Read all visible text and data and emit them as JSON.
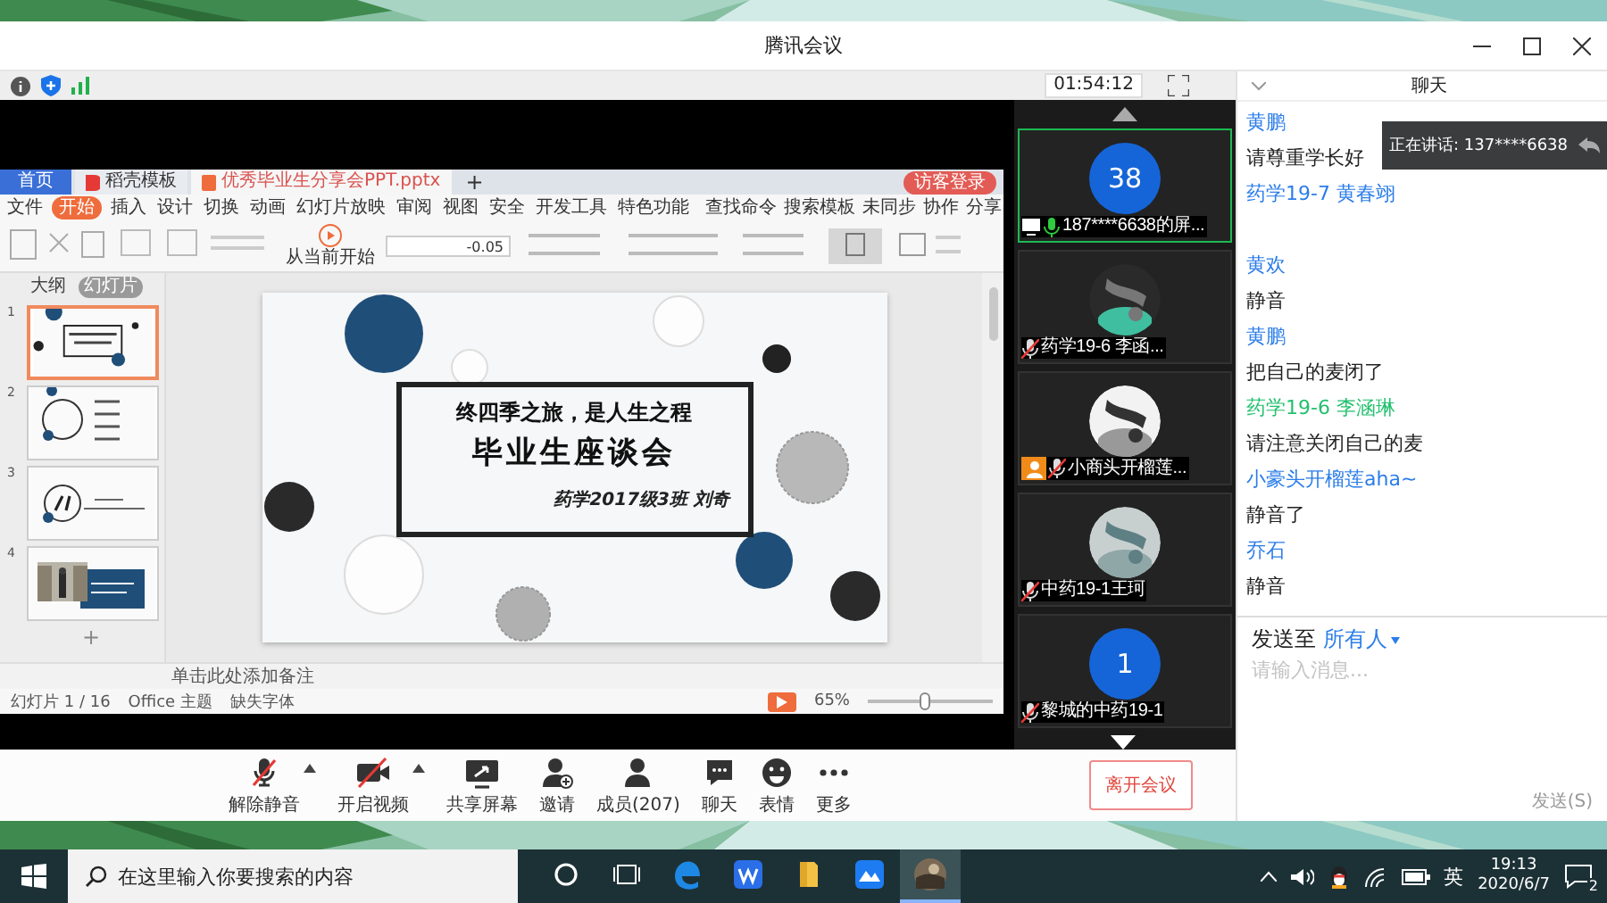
{
  "window": {
    "title": "腾讯会议"
  },
  "meeting_bar": {
    "timer": "01:54:12"
  },
  "shared_screen": {
    "tabs": [
      {
        "label": "首页",
        "kind": "home",
        "selected": false
      },
      {
        "label": "稻壳模板",
        "kind": "docer",
        "selected": false
      },
      {
        "label": "优秀毕业生分享会PPT.pptx",
        "kind": "document",
        "selected": true
      }
    ],
    "new_tab": "+",
    "login": "访客登录",
    "menu": [
      {
        "label": "文件",
        "selected": false
      },
      {
        "label": "开始",
        "selected": true
      },
      {
        "label": "插入",
        "selected": false
      },
      {
        "label": "设计",
        "selected": false
      },
      {
        "label": "切换",
        "selected": false
      },
      {
        "label": "动画",
        "selected": false
      },
      {
        "label": "幻灯片放映",
        "selected": false
      },
      {
        "label": "审阅",
        "selected": false
      },
      {
        "label": "视图",
        "selected": false
      },
      {
        "label": "安全",
        "selected": false
      },
      {
        "label": "开发工具",
        "selected": false
      },
      {
        "label": "特色功能",
        "selected": false
      }
    ],
    "search_command": "查找命令",
    "search_template": "搜索模板",
    "sync": "未同步",
    "collaborate": "协作",
    "share": "分享",
    "play_from_current": "从当前开始",
    "font_size": "-0.05",
    "panel_tabs": [
      {
        "label": "大纲",
        "selected": false
      },
      {
        "label": "幻灯片",
        "selected": true
      }
    ],
    "thumbnails": [
      {
        "number": "1",
        "selected": true,
        "kind": "title"
      },
      {
        "number": "2",
        "selected": false,
        "kind": "contents"
      },
      {
        "number": "3",
        "selected": false,
        "kind": "section"
      },
      {
        "number": "4",
        "selected": false
      }
    ],
    "add_slide": "+",
    "slide": {
      "line_1": "终四季之旅，是人生之程",
      "line_2": "毕业生座谈会",
      "author": "药学2017级3班 刘奇"
    },
    "notes_placeholder": "单击此处添加备注",
    "status": {
      "slide": "幻灯片 1 / 16",
      "theme": "Office 主题",
      "missing_fonts": "缺失字体",
      "zoom": "65%",
      "zoom_slider": {
        "level": 0.45
      }
    }
  },
  "participants": [
    {
      "label": "187****6638的屏...",
      "kind": "number",
      "avatar": "38",
      "muted": false,
      "selected": true,
      "sharing": true,
      "badge": false
    },
    {
      "label": "药学19-6 李函...",
      "kind": "picture",
      "muted": true,
      "selected": false,
      "sharing": false,
      "badge": false
    },
    {
      "label": "小商头开榴莲...",
      "kind": "picture",
      "muted": true,
      "selected": false,
      "sharing": false,
      "badge": true
    },
    {
      "label": "中药19-1王珂",
      "kind": "picture",
      "muted": true,
      "selected": false,
      "sharing": false,
      "badge": false
    },
    {
      "label": "黎城的中药19-1",
      "kind": "number",
      "avatar": "1",
      "muted": true,
      "selected": false,
      "sharing": false,
      "badge": false
    }
  ],
  "chat": {
    "title": "聊天",
    "speaking": "正在讲话: 137****6638",
    "messages": [
      {
        "sender": "黄鹏",
        "color": "#2b7de9",
        "text": "请尊重学长好"
      },
      {
        "sender": "药学19-7 黄春翊",
        "color": "#2b7de9"
      },
      {
        "sender": "黄欢",
        "color": "#2b7de9",
        "text": "静音"
      },
      {
        "sender": "黄鹏",
        "color": "#2b7de9",
        "text": "把自己的麦闭了"
      },
      {
        "sender": "药学19-6 李涵琳",
        "color": "#22c06e",
        "text": "请注意关闭自己的麦"
      },
      {
        "sender": "小豪头开榴莲aha~",
        "color": "#2b7de9",
        "text": "静音了"
      },
      {
        "sender": "乔石",
        "color": "#2b7de9",
        "text": "静音"
      }
    ],
    "send_to_label": "发送至",
    "send_to": "所有人",
    "placeholder": "请输入消息...",
    "send_button": "发送(S)"
  },
  "toolbar": {
    "buttons": [
      {
        "label": "解除静音",
        "kind": "mic-off",
        "has_menu": true
      },
      {
        "label": "开启视频",
        "kind": "video-off",
        "has_menu": true
      },
      {
        "label": "共享屏幕",
        "kind": "share",
        "has_menu": false
      },
      {
        "label": "邀请",
        "kind": "invite",
        "has_menu": false
      },
      {
        "label": "成员(207)",
        "kind": "members",
        "has_menu": false
      },
      {
        "label": "聊天",
        "kind": "chat",
        "has_menu": false
      },
      {
        "label": "表情",
        "kind": "emoji",
        "has_menu": false
      },
      {
        "label": "更多",
        "kind": "more",
        "has_menu": false
      }
    ],
    "leave": "离开会议"
  },
  "taskbar": {
    "search_placeholder": "在这里输入你要搜索的内容",
    "apps": [
      {
        "kind": "cortana",
        "selected": false
      },
      {
        "kind": "task-view",
        "selected": false
      },
      {
        "kind": "edge",
        "selected": false
      },
      {
        "kind": "wps",
        "selected": false
      },
      {
        "kind": "files",
        "selected": false
      },
      {
        "kind": "meeting",
        "selected": false
      },
      {
        "kind": "picture",
        "selected": true
      }
    ],
    "ime": "英",
    "time": "19:13",
    "date": "2020/6/7",
    "notifications": "2"
  }
}
